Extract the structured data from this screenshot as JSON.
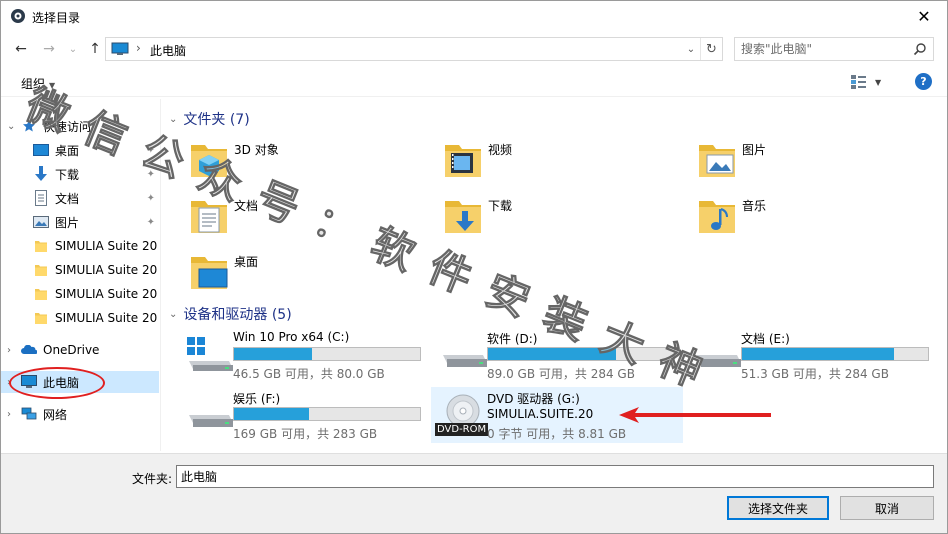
{
  "window": {
    "title": "选择目录",
    "close_glyph": "✕"
  },
  "nav_buttons": {
    "back": "←",
    "forward": "→",
    "recent": "⌄",
    "up": "↑"
  },
  "address": {
    "path": "此电脑",
    "separator": "›",
    "dropdown": "⌄",
    "refresh": "↻"
  },
  "search": {
    "placeholder": "搜索\"此电脑\""
  },
  "toolbar": {
    "organize": "组织",
    "organize_caret": "▼",
    "view_caret": "▼",
    "help": "?"
  },
  "sidebar": {
    "items": [
      {
        "label": "快速访问",
        "icon": "star-icon",
        "pinned": false
      },
      {
        "label": "桌面",
        "icon": "desktop-icon",
        "pinned": true
      },
      {
        "label": "下载",
        "icon": "download-icon",
        "pinned": true
      },
      {
        "label": "文档",
        "icon": "document-icon",
        "pinned": true
      },
      {
        "label": "图片",
        "icon": "pictures-icon",
        "pinned": true
      },
      {
        "label": "SIMULIA Suite 20",
        "icon": "folder-icon"
      },
      {
        "label": "SIMULIA Suite 20",
        "icon": "folder-icon"
      },
      {
        "label": "SIMULIA Suite 20",
        "icon": "folder-icon"
      },
      {
        "label": "SIMULIA Suite 20",
        "icon": "folder-icon"
      },
      {
        "label": "OneDrive",
        "icon": "onedrive-icon"
      },
      {
        "label": "此电脑",
        "icon": "computer-icon"
      },
      {
        "label": "网络",
        "icon": "network-icon"
      }
    ],
    "chevron_expanded": "⌄",
    "chevron_collapsed": "›",
    "pin_glyph": "📌"
  },
  "content": {
    "folders_header": "文件夹 (7)",
    "folders": [
      {
        "name": "3D 对象",
        "icon": "3d-objects-icon"
      },
      {
        "name": "视频",
        "icon": "videos-icon"
      },
      {
        "name": "图片",
        "icon": "pictures-icon"
      },
      {
        "name": "文档",
        "icon": "documents-icon"
      },
      {
        "name": "下载",
        "icon": "downloads-icon"
      },
      {
        "name": "音乐",
        "icon": "music-icon"
      },
      {
        "name": "桌面",
        "icon": "desktop-icon"
      }
    ],
    "drives_header": "设备和驱动器 (5)",
    "drives": [
      {
        "name": "Win 10 Pro x64 (C:)",
        "size": "46.5 GB 可用，共 80.0 GB",
        "used_fraction": 0.419,
        "icon": "windows-drive-icon"
      },
      {
        "name": "软件 (D:)",
        "size": "89.0 GB 可用，共 284 GB",
        "used_fraction": 0.687,
        "icon": "hard-drive-icon"
      },
      {
        "name": "文档 (E:)",
        "size": "51.3 GB 可用，共 284 GB",
        "used_fraction": 0.819,
        "icon": "hard-drive-icon"
      },
      {
        "name": "娱乐 (F:)",
        "size": "169 GB 可用，共 283 GB",
        "used_fraction": 0.403,
        "icon": "hard-drive-icon"
      },
      {
        "name": "DVD 驱动器 (G:)",
        "label": "SIMULIA.SUITE.20",
        "size": "0 字节 可用，共 8.81 GB",
        "icon": "dvd-drive-icon",
        "badge": "DVD-ROM"
      }
    ]
  },
  "bottom": {
    "folder_label": "文件夹:",
    "folder_value": "此电脑",
    "select_button": "选择文件夹",
    "cancel_button": "取消"
  },
  "watermark": {
    "text": "微信公众号：软件安装大神"
  },
  "colors": {
    "accent": "#0078d7",
    "bar_fill": "#26a0da",
    "header_text": "#1e3287",
    "selection": "#cce8ff",
    "annotation": "#e02020"
  }
}
